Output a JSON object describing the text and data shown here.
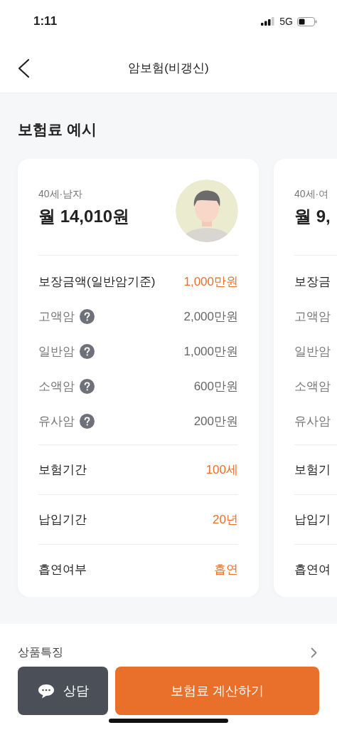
{
  "status_bar": {
    "time": "1:11",
    "network": "5G"
  },
  "header": {
    "title": "암보험(비갱신)"
  },
  "section_title": "보험료 예시",
  "cards": [
    {
      "subtitle": "40세·남자",
      "premium": "월 14,010원",
      "avatar": {
        "kind": "picture"
      },
      "coverage": {
        "label": "보장금액(일반암기준)",
        "value": "1,000만원"
      },
      "items": [
        {
          "label": "고액암",
          "value": "2,000만원",
          "help": true
        },
        {
          "label": "일반암",
          "value": "1,000만원",
          "help": true
        },
        {
          "label": "소액암",
          "value": "600만원",
          "help": true
        },
        {
          "label": "유사암",
          "value": "200만원",
          "help": true
        }
      ],
      "terms": [
        {
          "label": "보험기간",
          "value": "100세"
        },
        {
          "label": "납입기간",
          "value": "20년"
        },
        {
          "label": "흡연여부",
          "value": "흡연"
        }
      ]
    },
    {
      "subtitle": "40세·여",
      "premium": "월 9,",
      "coverage": {
        "label": "보장금"
      },
      "items": [
        {
          "label": "고액암"
        },
        {
          "label": "일반암"
        },
        {
          "label": "소액암"
        },
        {
          "label": "유사암"
        }
      ],
      "terms": [
        {
          "label": "보험기"
        },
        {
          "label": "납입기"
        },
        {
          "label": "흡연여"
        }
      ]
    }
  ],
  "features_link": "상품특징",
  "buttons": [
    {
      "kind": "secondary",
      "label": "상담"
    },
    {
      "kind": "primary",
      "label": "보험료 계산하기"
    }
  ]
}
